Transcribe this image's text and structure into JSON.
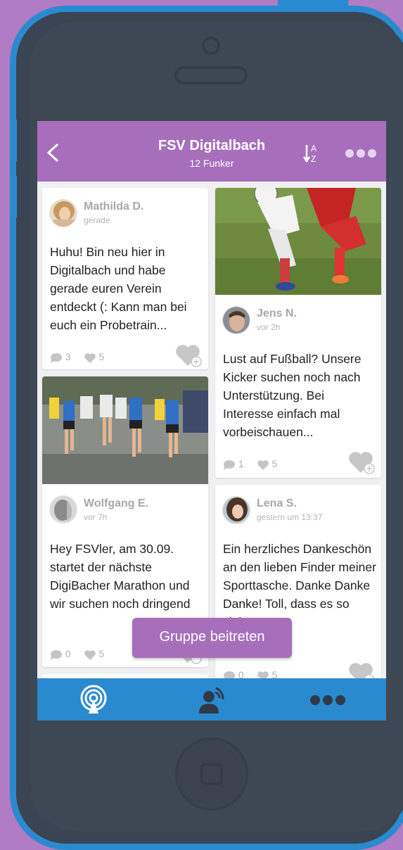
{
  "header": {
    "title": "FSV Digitalbach",
    "subtitle": "12 Funker",
    "sort_label": "AZ"
  },
  "posts": [
    {
      "author": "Mathilda D.",
      "time": "gerade",
      "text": "Huhu! Bin neu hier in Digitalbach und habe gerade euren Verein entdeckt (: Kann man bei euch ein Probetrain...",
      "comments": "3",
      "likes": "5"
    },
    {
      "author": "Jens N.",
      "time": "vor 2h",
      "text": "Lust auf Fußball? Unsere Kicker suchen noch nach Unterstützung. Bei Interesse einfach mal vorbeischauen...",
      "comments": "1",
      "likes": "5"
    },
    {
      "author": "Wolfgang E.",
      "time": "vor 7h",
      "text": "Hey FSVler, am 30.09. startet der nächste DigiBacher Marathon und wir suchen noch dringend nach freiwillige Helfer...",
      "comments": "0",
      "likes": "5"
    },
    {
      "author": "Lena S.",
      "time": "gestern um 13:37",
      "text": "Ein herzliches Dankeschön an den lieben Finder meiner Sporttasche. Danke Danke Danke! Toll, dass es so viele...",
      "comments": "0",
      "likes": "5"
    }
  ],
  "join_button": "Gruppe beitreten",
  "colors": {
    "header": "#a76fbb",
    "bottombar": "#2a8ad0",
    "background": "#b07cc4"
  },
  "icons": [
    "back-icon",
    "sort-az-icon",
    "more-icon",
    "comment-icon",
    "heart-icon",
    "heart-add-icon",
    "broadcast-icon",
    "user-signal-icon"
  ]
}
